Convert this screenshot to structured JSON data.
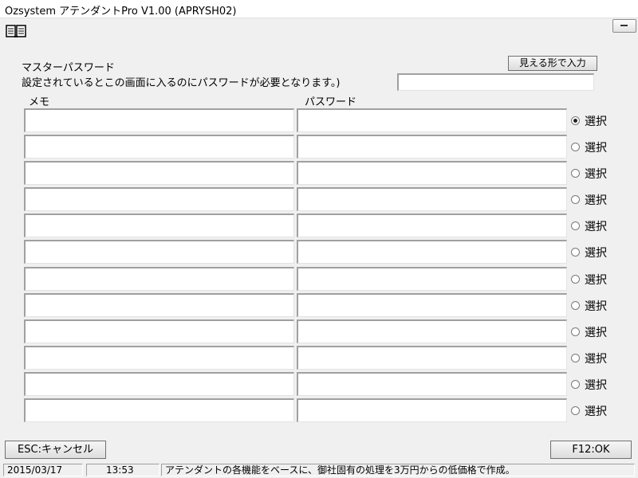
{
  "window": {
    "title": "Ozsystem アテンダントPro V1.00 (APRYSH02)"
  },
  "header": {
    "master_password_label": "マスターパスワード",
    "master_password_note": "設定されているとこの画面に入るのにパスワードが必要となります。)",
    "show_button": "見える形で入力",
    "master_password_value": ""
  },
  "table": {
    "columns": {
      "memo": "メモ",
      "password": "パスワード"
    },
    "rows": [
      {
        "memo": "",
        "password": "",
        "label": "選択",
        "selected": true
      },
      {
        "memo": "",
        "password": "",
        "label": "選択",
        "selected": false
      },
      {
        "memo": "",
        "password": "",
        "label": "選択",
        "selected": false
      },
      {
        "memo": "",
        "password": "",
        "label": "選択",
        "selected": false
      },
      {
        "memo": "",
        "password": "",
        "label": "選択",
        "selected": false
      },
      {
        "memo": "",
        "password": "",
        "label": "選択",
        "selected": false
      },
      {
        "memo": "",
        "password": "",
        "label": "選択",
        "selected": false
      },
      {
        "memo": "",
        "password": "",
        "label": "選択",
        "selected": false
      },
      {
        "memo": "",
        "password": "",
        "label": "選択",
        "selected": false
      },
      {
        "memo": "",
        "password": "",
        "label": "選択",
        "selected": false
      },
      {
        "memo": "",
        "password": "",
        "label": "選択",
        "selected": false
      },
      {
        "memo": "",
        "password": "",
        "label": "選択",
        "selected": false
      }
    ]
  },
  "footer": {
    "cancel_button": "ESC:キャンセル",
    "ok_button": "F12:OK"
  },
  "status": {
    "date": "2015/03/17",
    "time": "13:53",
    "message": "アテンダントの各機能をベースに、御社固有の処理を3万円からの低価格で作成。"
  }
}
